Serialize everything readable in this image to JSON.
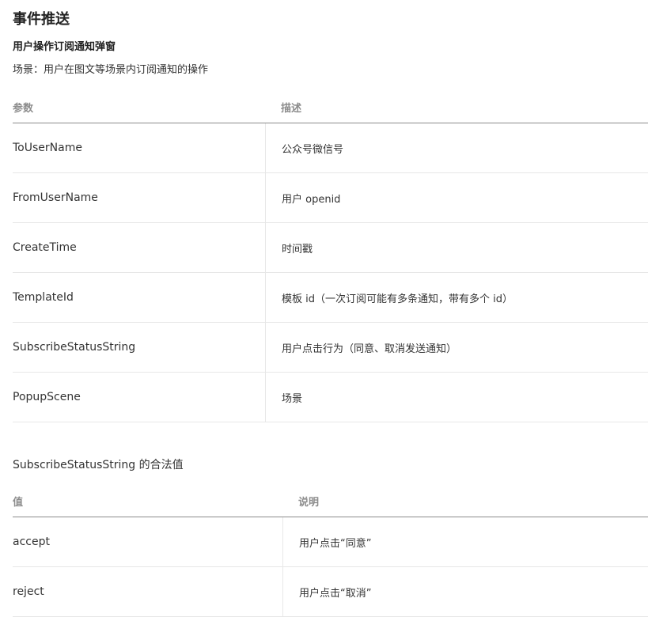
{
  "title": "事件推送",
  "subtitle": "用户操作订阅通知弹窗",
  "scene": "场景：用户在图文等场景内订阅通知的操作",
  "params_table": {
    "headers": [
      "参数",
      "描述"
    ],
    "rows": [
      {
        "param": "ToUserName",
        "desc": "公众号微信号"
      },
      {
        "param": "FromUserName",
        "desc": "用户 openid"
      },
      {
        "param": "CreateTime",
        "desc": "时间戳"
      },
      {
        "param": "TemplateId",
        "desc": "模板 id（一次订阅可能有多条通知，带有多个 id）"
      },
      {
        "param": "SubscribeStatusString",
        "desc": "用户点击行为（同意、取消发送通知）"
      },
      {
        "param": "PopupScene",
        "desc": "场景"
      }
    ]
  },
  "values_heading": "SubscribeStatusString 的合法值",
  "values_table": {
    "headers": [
      "值",
      "说明"
    ],
    "rows": [
      {
        "value": "accept",
        "desc": "用户点击“同意”"
      },
      {
        "value": "reject",
        "desc": "用户点击“取消”"
      }
    ]
  }
}
